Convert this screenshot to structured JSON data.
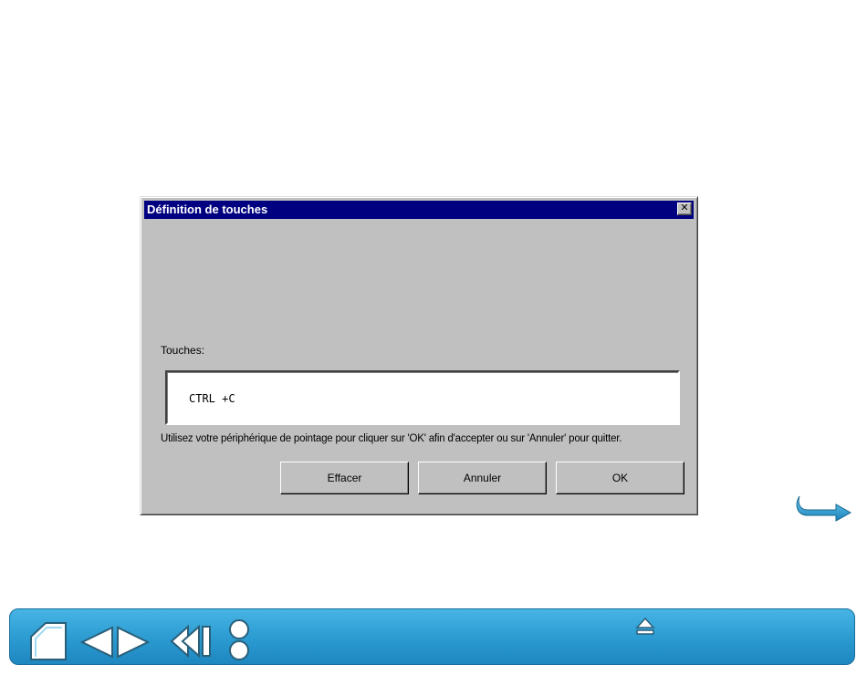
{
  "dialog": {
    "title": "Définition de touches",
    "close_glyph": "✕",
    "keys_label": "Touches:",
    "keys_value": "CTRL +C",
    "instruction": "Utilisez votre périphérique de pointage pour cliquer sur 'OK' afin d'accepter ou sur 'Annuler' pour quitter.",
    "buttons": {
      "clear": "Effacer",
      "cancel": "Annuler",
      "ok": "OK"
    }
  },
  "navigation": {
    "icons": [
      "home-icon",
      "previous-page-icon",
      "next-page-icon",
      "back-icon",
      "index-icon",
      "eject-icon",
      "next-arrow-icon"
    ]
  },
  "colors": {
    "titlebar": "#000080",
    "dialog_face": "#c0c0c0",
    "toolbar": "#2a9ad0",
    "icon_fill": "#ffffff"
  }
}
